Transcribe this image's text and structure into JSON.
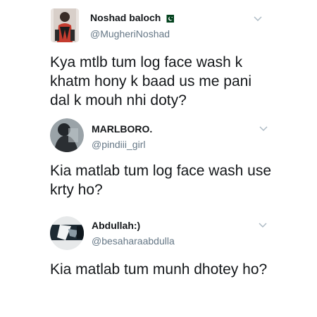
{
  "tweets": [
    {
      "name": "Noshad baloch",
      "flag_icon": "pakistan-flag-icon",
      "handle": "@MugheriNoshad",
      "text": "Kya mtlb tum log face wash k khatm hony k baad us me pani dal k mouh nhi doty?"
    },
    {
      "name": "MARLBORO.",
      "handle": "@pindiii_girl",
      "text": "Kia matlab tum log face wash use krty ho?"
    },
    {
      "name": "Abdullah:)",
      "handle": "@besaharaabdulla",
      "text": "Kia matlab tum munh dhotey ho?"
    }
  ],
  "colors": {
    "text_primary": "#14171a",
    "text_secondary": "#657786",
    "chevron": "#aab8c2",
    "flag_green": "#01411c"
  }
}
